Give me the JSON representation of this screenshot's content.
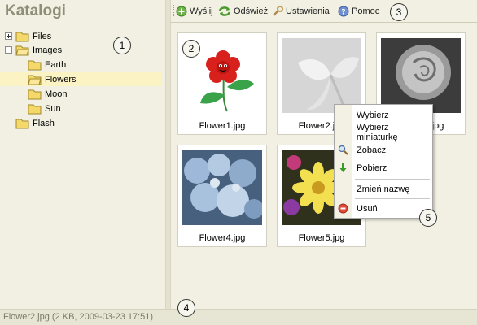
{
  "sidebar": {
    "title": "Katalogi",
    "tree": [
      {
        "label": "Files",
        "expander": "+"
      },
      {
        "label": "Images",
        "expander": "-"
      },
      {
        "label": "Earth"
      },
      {
        "label": "Flowers",
        "selected": true
      },
      {
        "label": "Moon"
      },
      {
        "label": "Sun"
      },
      {
        "label": "Flash"
      }
    ]
  },
  "toolbar": {
    "buttons": [
      {
        "label": "Wyślij",
        "icon": "upload-icon"
      },
      {
        "label": "Odśwież",
        "icon": "refresh-icon"
      },
      {
        "label": "Ustawienia",
        "icon": "settings-icon"
      },
      {
        "label": "Pomoc",
        "icon": "help-icon"
      }
    ]
  },
  "thumbnails": [
    {
      "name": "Flower1.jpg"
    },
    {
      "name": "Flower2.jpg"
    },
    {
      "name": "Flower3.jpg"
    },
    {
      "name": "Flower4.jpg"
    },
    {
      "name": "Flower5.jpg"
    }
  ],
  "context_menu": {
    "items": [
      "Wybierz",
      "Wybierz miniaturkę",
      "Zobacz",
      "Pobierz",
      "Zmień nazwę",
      "Usuń"
    ]
  },
  "status": {
    "text": "Flower2.jpg (2 KB, 2009-03-23 17:51)"
  },
  "markers": [
    "1",
    "2",
    "3",
    "4",
    "5"
  ],
  "colors": {
    "folder": "#f5d86a",
    "selected": "#fbf3c4",
    "panel": "#f1f0e2"
  }
}
